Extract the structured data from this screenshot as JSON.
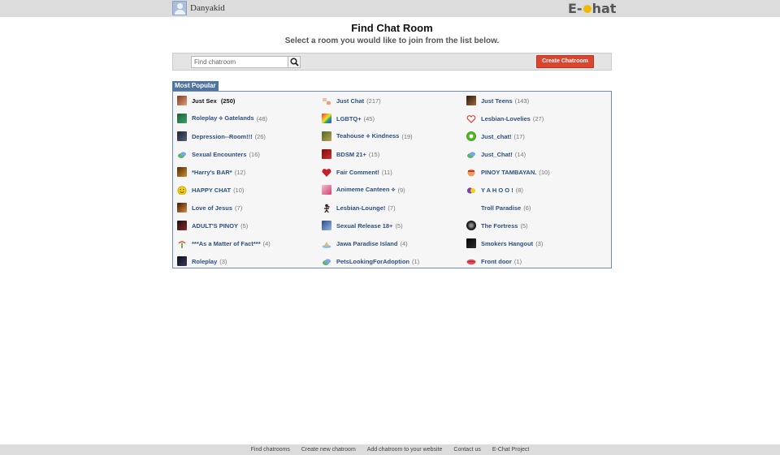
{
  "topbar": {
    "username": "Danyakid",
    "logo_text": "E-chat"
  },
  "header": {
    "title": "Find Chat Room",
    "subtitle": "Select a room you would like to join from the list below."
  },
  "search": {
    "placeholder": "Find chatroom",
    "value": "",
    "create_label": "Create Chatroom"
  },
  "section": {
    "label": "Most Popular"
  },
  "rooms": [
    {
      "name": "Just Sex",
      "count": "(250)"
    },
    {
      "name": "Just Chat",
      "count": "(217)"
    },
    {
      "name": "Just Teens",
      "count": "(143)"
    },
    {
      "name": "Roleplay ⟡ Gatelands",
      "count": "(48)"
    },
    {
      "name": "LGBTQ+",
      "count": "(45)"
    },
    {
      "name": "Lesbian-Lovelies",
      "count": "(27)"
    },
    {
      "name": "Depression--Room!!!",
      "count": "(26)"
    },
    {
      "name": "Teahouse ⟡ Kindness",
      "count": "(19)"
    },
    {
      "name": "Just_chat!",
      "count": "(17)"
    },
    {
      "name": "Sexual Encounters",
      "count": "(16)"
    },
    {
      "name": "BDSM  21+",
      "count": "(15)"
    },
    {
      "name": "Just_Chat!",
      "count": "(14)"
    },
    {
      "name": "*Harry's BAR*",
      "count": "(12)"
    },
    {
      "name": "Fair Comment!",
      "count": "(11)"
    },
    {
      "name": "PINOY TAMBAYAN.",
      "count": "(10)"
    },
    {
      "name": "HAPPY CHAT",
      "count": "(10)"
    },
    {
      "name": "Animeme Canteen ⟡",
      "count": "(9)"
    },
    {
      "name": "Y A H O O !",
      "count": "(8)"
    },
    {
      "name": "Love of Jesus",
      "count": "(7)"
    },
    {
      "name": "Lesbian-Lounge!",
      "count": "(7)"
    },
    {
      "name": "Troll Paradise",
      "count": "(6)"
    },
    {
      "name": "ADULT'S PINOY",
      "count": "(5)"
    },
    {
      "name": "Sexual Release 18+",
      "count": "(5)"
    },
    {
      "name": "The Fortress",
      "count": "(5)"
    },
    {
      "name": "***As a Matter of Fact***",
      "count": "(4)"
    },
    {
      "name": "Jawa Paradise Island",
      "count": "(4)"
    },
    {
      "name": "Smokers Hangout",
      "count": "(3)"
    },
    {
      "name": "Roleplay",
      "count": "(3)"
    },
    {
      "name": "PetsLookingForAdoption",
      "count": "(1)"
    },
    {
      "name": "Front door",
      "count": "(1)"
    }
  ],
  "footer": {
    "links": [
      "Find chatrooms",
      "Create new chatroom",
      "Add chatroom to your website",
      "Contact us",
      "E-Chat Project"
    ]
  },
  "colors": {
    "accent_red": "#d9452f",
    "link_blue": "#2c4f82",
    "tab_blue": "#5074a0",
    "bar_gray": "#dcdcdc"
  }
}
